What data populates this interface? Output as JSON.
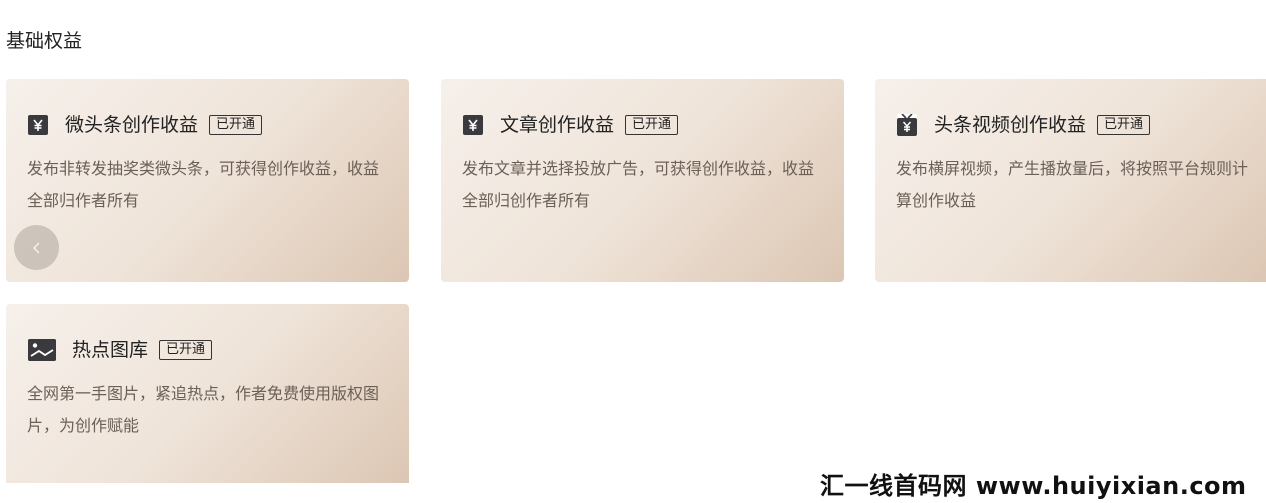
{
  "section": {
    "title": "基础权益"
  },
  "cards": [
    {
      "icon": "yuan-icon",
      "title": "微头条创作收益",
      "badge": "已开通",
      "desc": "发布非转发抽奖类微头条，可获得创作收益，收益全部归作者所有"
    },
    {
      "icon": "yuan-icon",
      "title": "文章创作收益",
      "badge": "已开通",
      "desc": "发布文章并选择投放广告，可获得创作收益，收益全部归创作者所有"
    },
    {
      "icon": "tv-yuan-icon",
      "title": "头条视频创作收益",
      "badge": "已开通",
      "desc": "发布横屏视频，产生播放量后，将按照平台规则计算创作收益"
    },
    {
      "icon": "image-icon",
      "title": "热点图库",
      "badge": "已开通",
      "desc": "全网第一手图片，紧追热点，作者免费使用版权图片，为创作赋能"
    }
  ],
  "carousel": {
    "prev_icon": "chevron-left-icon"
  },
  "watermark": {
    "text": "汇一线首码网 www.huiyixian.com"
  },
  "colors": {
    "card_gradient_start": "#f6f0eb",
    "card_gradient_end": "#dcc6b3",
    "icon_bg": "#3a3a3e",
    "desc_text": "#6b5f57"
  }
}
